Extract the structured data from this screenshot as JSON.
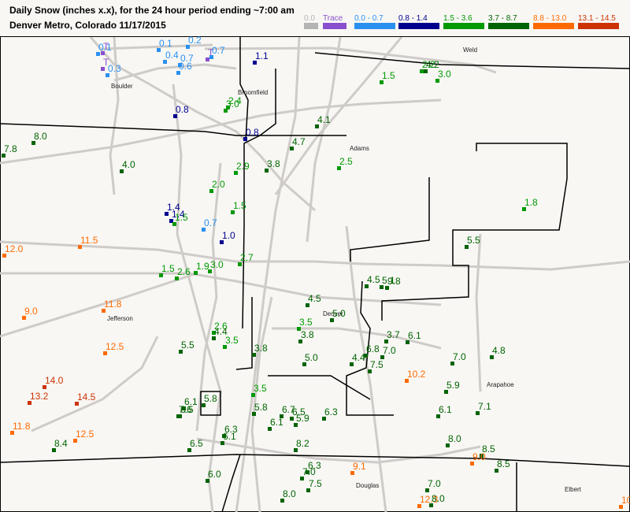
{
  "header": {
    "title_line1": "Daily Snow (inches  x.x),  for the 24 hour period ending ~7:00 am",
    "title_line2": "Denver Metro, Colorado  11/17/2015"
  },
  "legend": [
    {
      "label": "0.0",
      "color": "#b4b4b4"
    },
    {
      "label": "Trace",
      "color": "#8a4fcf"
    },
    {
      "label": "0.0 - 0.7",
      "color": "#2a90f0"
    },
    {
      "label": "0.8 - 1.4",
      "color": "#00008f"
    },
    {
      "label": "1.5 - 3.6",
      "color": "#009900"
    },
    {
      "label": "3.7 - 8.7",
      "color": "#006400"
    },
    {
      "label": "8.8 - 13.0",
      "color": "#ff6a00"
    },
    {
      "label": "13.1 - 14.5",
      "color": "#cc3300"
    }
  ],
  "places": [
    {
      "name": "Boulder"
    },
    {
      "name": "Broomfield"
    },
    {
      "name": "Weld"
    },
    {
      "name": "Adams"
    },
    {
      "name": "Jefferson"
    },
    {
      "name": "Denver"
    },
    {
      "name": "Arapahoe"
    },
    {
      "name": "Douglas"
    },
    {
      "name": "Elbert"
    }
  ],
  "stations": [
    {
      "v": "0.1",
      "c": "#2a90f0"
    },
    {
      "v": "T",
      "c": "#8a4fcf"
    },
    {
      "v": "T",
      "c": "#8a4fcf"
    },
    {
      "v": "0.3",
      "c": "#2a90f0"
    },
    {
      "v": "0.1",
      "c": "#2a90f0"
    },
    {
      "v": "0.2",
      "c": "#2a90f0"
    },
    {
      "v": "0.4",
      "c": "#2a90f0"
    },
    {
      "v": "0.7",
      "c": "#2a90f0"
    },
    {
      "v": "0.6",
      "c": "#2a90f0"
    },
    {
      "v": "T",
      "c": "#8a4fcf"
    },
    {
      "v": "0.7",
      "c": "#2a90f0"
    },
    {
      "v": "1.1",
      "c": "#00008f"
    },
    {
      "v": "0.8",
      "c": "#00008f"
    },
    {
      "v": "2.4",
      "c": "#009900"
    },
    {
      "v": "3.0",
      "c": "#009900"
    },
    {
      "v": "0.8",
      "c": "#00008f"
    },
    {
      "v": "4.7",
      "c": "#006400"
    },
    {
      "v": "8.0",
      "c": "#006400"
    },
    {
      "v": "7.8",
      "c": "#006400"
    },
    {
      "v": "1.5",
      "c": "#009900"
    },
    {
      "v": "2.2",
      "c": "#009900"
    },
    {
      "v": "4.2",
      "c": "#006400"
    },
    {
      "v": "3.0",
      "c": "#009900"
    },
    {
      "v": "4.1",
      "c": "#006400"
    },
    {
      "v": "4.0",
      "c": "#006400"
    },
    {
      "v": "2.9",
      "c": "#009900"
    },
    {
      "v": "3.8",
      "c": "#006400"
    },
    {
      "v": "2.0",
      "c": "#009900"
    },
    {
      "v": "2.5",
      "c": "#009900"
    },
    {
      "v": "1.5",
      "c": "#009900"
    },
    {
      "v": "1.4",
      "c": "#00008f"
    },
    {
      "v": "1.4",
      "c": "#00008f"
    },
    {
      "v": "1.5",
      "c": "#009900"
    },
    {
      "v": "0.7",
      "c": "#2a90f0"
    },
    {
      "v": "1.0",
      "c": "#00008f"
    },
    {
      "v": "1.8",
      "c": "#009900"
    },
    {
      "v": "11.5",
      "c": "#ff6a00"
    },
    {
      "v": "12.0",
      "c": "#ff6a00"
    },
    {
      "v": "5.5",
      "c": "#006400"
    },
    {
      "v": "2.7",
      "c": "#009900"
    },
    {
      "v": "1.5",
      "c": "#009900"
    },
    {
      "v": "2.6",
      "c": "#009900"
    },
    {
      "v": "1.9",
      "c": "#009900"
    },
    {
      "v": "3.0",
      "c": "#009900"
    },
    {
      "v": "4.5",
      "c": "#006400"
    },
    {
      "v": "5.1",
      "c": "#006400"
    },
    {
      "v": "9.8",
      "c": "#006400"
    },
    {
      "v": "4.5",
      "c": "#006400"
    },
    {
      "v": "11.8",
      "c": "#ff6a00"
    },
    {
      "v": "9.0",
      "c": "#ff6a00"
    },
    {
      "v": "5.0",
      "c": "#006400"
    },
    {
      "v": "3.5",
      "c": "#009900"
    },
    {
      "v": "3.8",
      "c": "#006400"
    },
    {
      "v": "2.6",
      "c": "#009900"
    },
    {
      "v": "4.4",
      "c": "#006400"
    },
    {
      "v": "3.5",
      "c": "#009900"
    },
    {
      "v": "3.7",
      "c": "#006400"
    },
    {
      "v": "6.1",
      "c": "#006400"
    },
    {
      "v": "5.5",
      "c": "#006400"
    },
    {
      "v": "3.8",
      "c": "#006400"
    },
    {
      "v": "12.5",
      "c": "#ff6a00"
    },
    {
      "v": "6.8",
      "c": "#006400"
    },
    {
      "v": "7.0",
      "c": "#006400"
    },
    {
      "v": "4.8",
      "c": "#006400"
    },
    {
      "v": "7.0",
      "c": "#006400"
    },
    {
      "v": "5.0",
      "c": "#006400"
    },
    {
      "v": "4.4",
      "c": "#006400"
    },
    {
      "v": "7.5",
      "c": "#006400"
    },
    {
      "v": "10.2",
      "c": "#ff6a00"
    },
    {
      "v": "14.0",
      "c": "#cc3300"
    },
    {
      "v": "3.5",
      "c": "#009900"
    },
    {
      "v": "5.9",
      "c": "#006400"
    },
    {
      "v": "13.2",
      "c": "#cc3300"
    },
    {
      "v": "14.5",
      "c": "#cc3300"
    },
    {
      "v": "6.1",
      "c": "#006400"
    },
    {
      "v": "5.8",
      "c": "#006400"
    },
    {
      "v": "7.6",
      "c": "#006400"
    },
    {
      "v": "6.5",
      "c": "#006400"
    },
    {
      "v": "5.8",
      "c": "#006400"
    },
    {
      "v": "6.7",
      "c": "#006400"
    },
    {
      "v": "6.5",
      "c": "#006400"
    },
    {
      "v": "6.1",
      "c": "#006400"
    },
    {
      "v": "5.9",
      "c": "#006400"
    },
    {
      "v": "6.3",
      "c": "#006400"
    },
    {
      "v": "6.1",
      "c": "#006400"
    },
    {
      "v": "7.1",
      "c": "#006400"
    },
    {
      "v": "11.8",
      "c": "#ff6a00"
    },
    {
      "v": "12.5",
      "c": "#ff6a00"
    },
    {
      "v": "6.3",
      "c": "#006400"
    },
    {
      "v": "6.1",
      "c": "#006400"
    },
    {
      "v": "8.4",
      "c": "#006400"
    },
    {
      "v": "6.5",
      "c": "#006400"
    },
    {
      "v": "8.2",
      "c": "#006400"
    },
    {
      "v": "8.0",
      "c": "#006400"
    },
    {
      "v": "8.5",
      "c": "#006400"
    },
    {
      "v": "9.0",
      "c": "#ff6a00"
    },
    {
      "v": "6.3",
      "c": "#006400"
    },
    {
      "v": "7.0",
      "c": "#006400"
    },
    {
      "v": "9.1",
      "c": "#ff6a00"
    },
    {
      "v": "8.5",
      "c": "#006400"
    },
    {
      "v": "6.0",
      "c": "#006400"
    },
    {
      "v": "7.5",
      "c": "#006400"
    },
    {
      "v": "7.0",
      "c": "#006400"
    },
    {
      "v": "8.0",
      "c": "#006400"
    },
    {
      "v": "12.3",
      "c": "#ff6a00"
    },
    {
      "v": "8.0",
      "c": "#006400"
    },
    {
      "v": "10",
      "c": "#ff6a00"
    }
  ]
}
